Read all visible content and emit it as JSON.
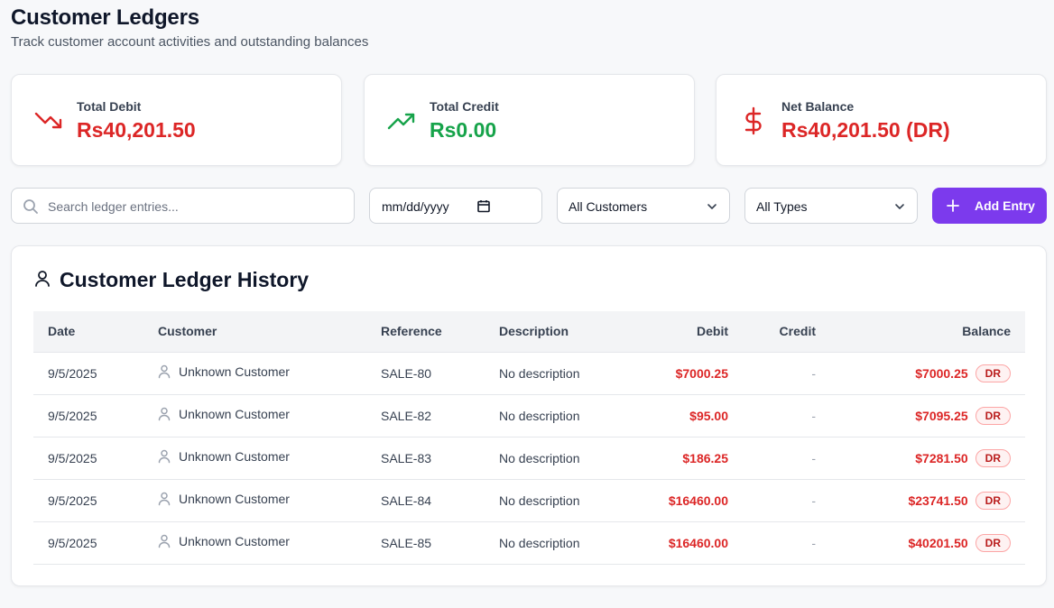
{
  "header": {
    "title": "Customer Ledgers",
    "subtitle": "Track customer account activities and outstanding balances"
  },
  "summary": [
    {
      "label": "Total Debit",
      "value": "Rs40,201.50",
      "icon": "trending-down-icon",
      "color": "#dc2626"
    },
    {
      "label": "Total Credit",
      "value": "Rs0.00",
      "icon": "trending-up-icon",
      "color": "#16a34a"
    },
    {
      "label": "Net Balance",
      "value": "Rs40,201.50 (DR)",
      "icon": "dollar-icon",
      "color": "#dc2626"
    }
  ],
  "filters": {
    "search_placeholder": "Search ledger entries...",
    "date_placeholder": "mm/dd/yyyy",
    "customer_select": "All Customers",
    "type_select": "All Types",
    "add_button": "Add Entry"
  },
  "ledger": {
    "title": "Customer Ledger History",
    "columns": [
      "Date",
      "Customer",
      "Reference",
      "Description",
      "Debit",
      "Credit",
      "Balance"
    ],
    "rows": [
      {
        "date": "9/5/2025",
        "customer": "Unknown Customer",
        "reference": "SALE-80",
        "description": "No description",
        "debit": "$7000.25",
        "credit": "-",
        "balance": "$7000.25",
        "badge": "DR"
      },
      {
        "date": "9/5/2025",
        "customer": "Unknown Customer",
        "reference": "SALE-82",
        "description": "No description",
        "debit": "$95.00",
        "credit": "-",
        "balance": "$7095.25",
        "badge": "DR"
      },
      {
        "date": "9/5/2025",
        "customer": "Unknown Customer",
        "reference": "SALE-83",
        "description": "No description",
        "debit": "$186.25",
        "credit": "-",
        "balance": "$7281.50",
        "badge": "DR"
      },
      {
        "date": "9/5/2025",
        "customer": "Unknown Customer",
        "reference": "SALE-84",
        "description": "No description",
        "debit": "$16460.00",
        "credit": "-",
        "balance": "$23741.50",
        "badge": "DR"
      },
      {
        "date": "9/5/2025",
        "customer": "Unknown Customer",
        "reference": "SALE-85",
        "description": "No description",
        "debit": "$16460.00",
        "credit": "-",
        "balance": "$40201.50",
        "badge": "DR"
      }
    ]
  },
  "colors": {
    "accent": "#7c3aed",
    "debit": "#dc2626",
    "credit": "#16a34a"
  }
}
